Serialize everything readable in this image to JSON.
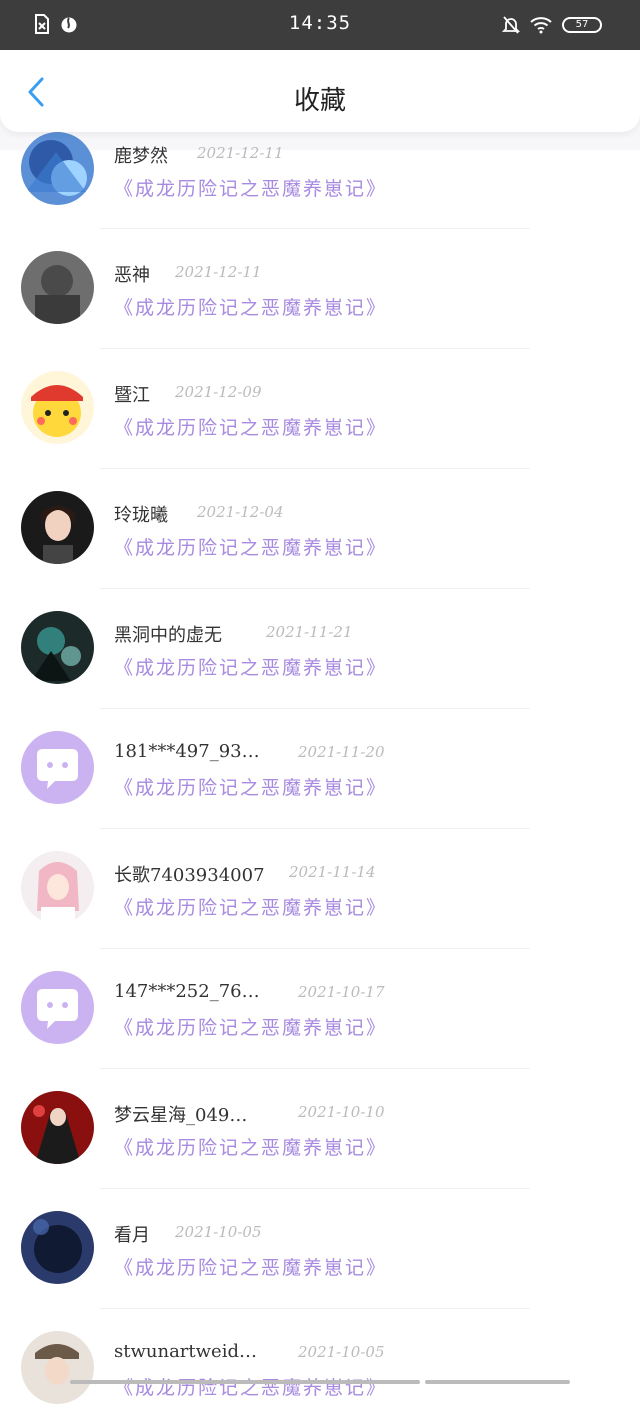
{
  "status_bar": {
    "time": "14:35",
    "battery_label": "57"
  },
  "header": {
    "title": "收藏"
  },
  "items": [
    {
      "name": "鹿梦然",
      "date": "2021-12-11",
      "book": "《成龙历险记之恶魔养崽记》",
      "avatar": "anime-blue"
    },
    {
      "name": "恶神",
      "date": "2021-12-11",
      "book": "《成龙历险记之恶魔养崽记》",
      "avatar": "grey-portrait"
    },
    {
      "name": "暨江",
      "date": "2021-12-09",
      "book": "《成龙历险记之恶魔养崽记》",
      "avatar": "pikachu"
    },
    {
      "name": "玲珑曦",
      "date": "2021-12-04",
      "book": "《成龙历险记之恶魔养崽记》",
      "avatar": "girl-photo"
    },
    {
      "name": "黑洞中的虚无",
      "date": "2021-11-21",
      "book": "《成龙历险记之恶魔养崽记》",
      "avatar": "dark-anime"
    },
    {
      "name": "181***497_93…",
      "date": "2021-11-20",
      "book": "《成龙历险记之恶魔养崽记》",
      "avatar": "default"
    },
    {
      "name": "长歌7403934007",
      "date": "2021-11-14",
      "book": "《成龙历险记之恶魔养崽记》",
      "avatar": "pink-anime"
    },
    {
      "name": "147***252_76…",
      "date": "2021-10-17",
      "book": "《成龙历险记之恶魔养崽记》",
      "avatar": "default"
    },
    {
      "name": "梦云星海_049…",
      "date": "2021-10-10",
      "book": "《成龙历险记之恶魔养崽记》",
      "avatar": "red-anime"
    },
    {
      "name": "看月",
      "date": "2021-10-05",
      "book": "《成龙历险记之恶魔养崽记》",
      "avatar": "blue-hair"
    },
    {
      "name": "stwunartweid…",
      "date": "2021-10-05",
      "book": "《成龙历险记之恶魔养崽记》",
      "avatar": "hat-photo"
    }
  ],
  "colors": {
    "accent": "#3a9ef5",
    "book_title": "#a88be0",
    "default_avatar": "#cbb2f0"
  }
}
